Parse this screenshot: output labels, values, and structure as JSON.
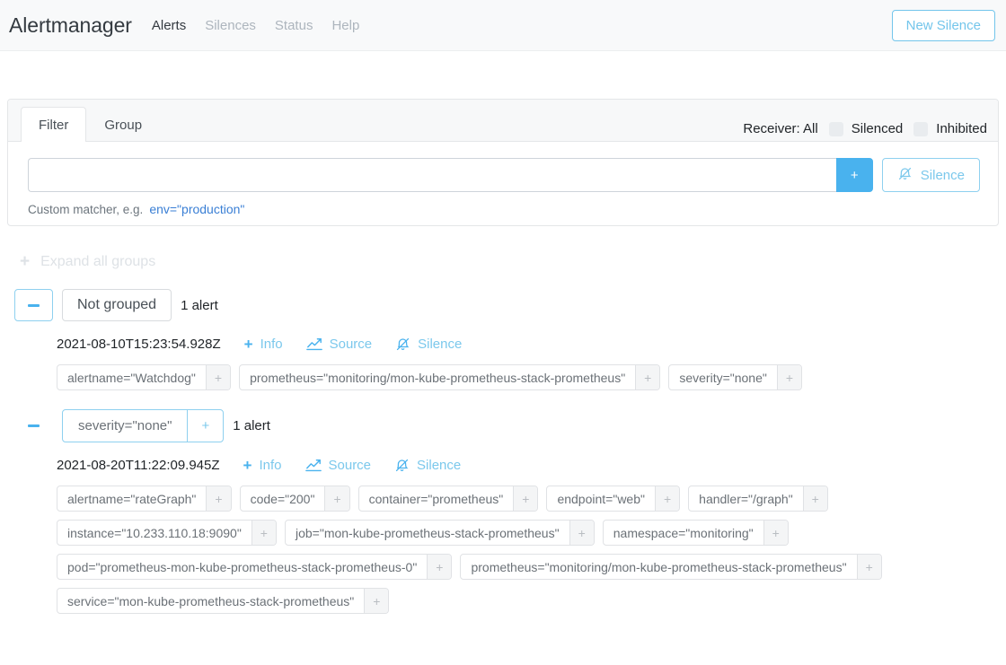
{
  "navbar": {
    "brand": "Alertmanager",
    "links": [
      {
        "label": "Alerts",
        "active": true
      },
      {
        "label": "Silences",
        "active": false
      },
      {
        "label": "Status",
        "active": false
      },
      {
        "label": "Help",
        "active": false
      }
    ],
    "new_silence_label": "New Silence"
  },
  "filter_card": {
    "tabs": [
      {
        "label": "Filter",
        "active": true
      },
      {
        "label": "Group",
        "active": false
      }
    ],
    "receiver_label": "Receiver: All",
    "checkboxes": [
      {
        "label": "Silenced",
        "checked": false
      },
      {
        "label": "Inhibited",
        "checked": false
      }
    ],
    "matcher_input": {
      "value": "",
      "placeholder": ""
    },
    "add_button_label": "+",
    "silence_button_label": "Silence",
    "helper_text": "Custom matcher, e.g.",
    "helper_code": "env=\"production\""
  },
  "expand_all": {
    "label": "Expand all groups",
    "icon": "+"
  },
  "groups": [
    {
      "collapse_icon": "minus",
      "boxed_toggle": true,
      "name": "Not grouped",
      "name_is_badge": false,
      "badge_plus": "+",
      "alert_count": "1 alert",
      "alerts": [
        {
          "time": "2021-08-10T15:23:54.928Z",
          "actions": [
            {
              "label": "Info",
              "icon": "plus-icon"
            },
            {
              "label": "Source",
              "icon": "chart-line-icon"
            },
            {
              "label": "Silence",
              "icon": "bell-slash-icon"
            }
          ],
          "label_rows": [
            [
              "alertname=\"Watchdog\"",
              "prometheus=\"monitoring/mon-kube-prometheus-stack-prometheus\"",
              "severity=\"none\""
            ]
          ]
        }
      ]
    },
    {
      "collapse_icon": "minus",
      "boxed_toggle": false,
      "name": "severity=\"none\"",
      "name_is_badge": true,
      "badge_plus": "+",
      "alert_count": "1 alert",
      "alerts": [
        {
          "time": "2021-08-20T11:22:09.945Z",
          "actions": [
            {
              "label": "Info",
              "icon": "plus-icon"
            },
            {
              "label": "Source",
              "icon": "chart-line-icon"
            },
            {
              "label": "Silence",
              "icon": "bell-slash-icon"
            }
          ],
          "label_rows": [
            [
              "alertname=\"rateGraph\"",
              "code=\"200\"",
              "container=\"prometheus\"",
              "endpoint=\"web\"",
              "handler=\"/graph\""
            ],
            [
              "instance=\"10.233.110.18:9090\"",
              "job=\"mon-kube-prometheus-stack-prometheus\"",
              "namespace=\"monitoring\""
            ],
            [
              "pod=\"prometheus-mon-kube-prometheus-stack-prometheus-0\"",
              "prometheus=\"monitoring/mon-kube-prometheus-stack-prometheus\""
            ],
            [
              "service=\"mon-kube-prometheus-stack-prometheus\""
            ]
          ]
        }
      ]
    }
  ],
  "label_plus": "+",
  "colors": {
    "accent": "#49b2ee",
    "accent_light": "#7bc8ec",
    "navbar_bg": "#f8f9fa",
    "muted": "#adb5bd"
  }
}
